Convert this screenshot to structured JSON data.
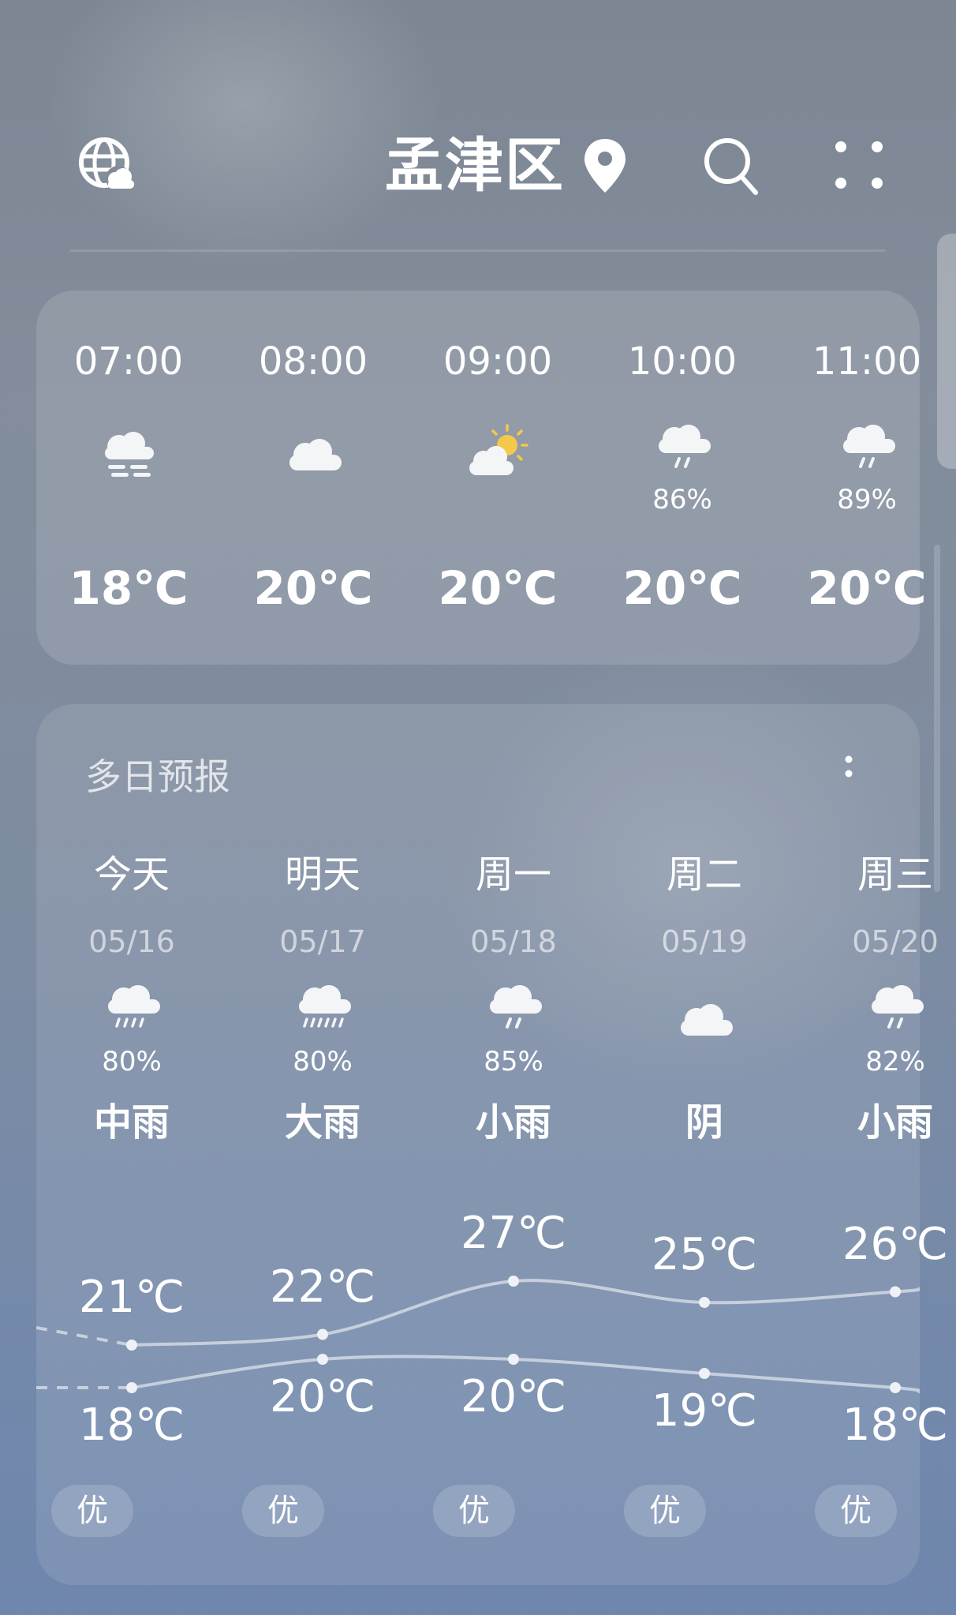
{
  "header": {
    "city": "孟津区",
    "globe_icon": "globe-weather-icon",
    "location_icon": "location-pin-icon",
    "search_icon": "search-icon",
    "menu_icon": "grid-menu-icon"
  },
  "hourly": [
    {
      "time": "07:00",
      "icon": "fog-icon",
      "precip": "",
      "temp": "18℃"
    },
    {
      "time": "08:00",
      "icon": "cloudy-icon",
      "precip": "",
      "temp": "20℃"
    },
    {
      "time": "09:00",
      "icon": "partly-sunny-icon",
      "precip": "",
      "temp": "20℃"
    },
    {
      "time": "10:00",
      "icon": "light-rain-icon",
      "precip": "86%",
      "temp": "20℃"
    },
    {
      "time": "11:00",
      "icon": "light-rain-icon",
      "precip": "89%",
      "temp": "20℃"
    }
  ],
  "daily": {
    "title": "多日预报",
    "days": [
      {
        "weekday": "今天",
        "date": "05/16",
        "icon": "moderate-rain-icon",
        "precip": "80%",
        "condition": "中雨",
        "high": 21,
        "high_label": "21℃",
        "low": 18,
        "low_label": "18℃",
        "aqi": "优"
      },
      {
        "weekday": "明天",
        "date": "05/17",
        "icon": "heavy-rain-icon",
        "precip": "80%",
        "condition": "大雨",
        "high": 22,
        "high_label": "22℃",
        "low": 20,
        "low_label": "20℃",
        "aqi": "优"
      },
      {
        "weekday": "周一",
        "date": "05/18",
        "icon": "light-rain-icon",
        "precip": "85%",
        "condition": "小雨",
        "high": 27,
        "high_label": "27℃",
        "low": 20,
        "low_label": "20℃",
        "aqi": "优"
      },
      {
        "weekday": "周二",
        "date": "05/19",
        "icon": "overcast-icon",
        "precip": "",
        "condition": "阴",
        "high": 25,
        "high_label": "25℃",
        "low": 19,
        "low_label": "19℃",
        "aqi": "优"
      },
      {
        "weekday": "周三",
        "date": "05/20",
        "icon": "light-rain-icon",
        "precip": "82%",
        "condition": "小雨",
        "high": 26,
        "high_label": "26℃",
        "low": 18,
        "low_label": "18℃",
        "aqi": "优"
      }
    ]
  },
  "colors": {
    "sun": "#f4c84a",
    "cloud": "#f4f5f7",
    "curve": "rgba(255,255,255,0.55)"
  }
}
